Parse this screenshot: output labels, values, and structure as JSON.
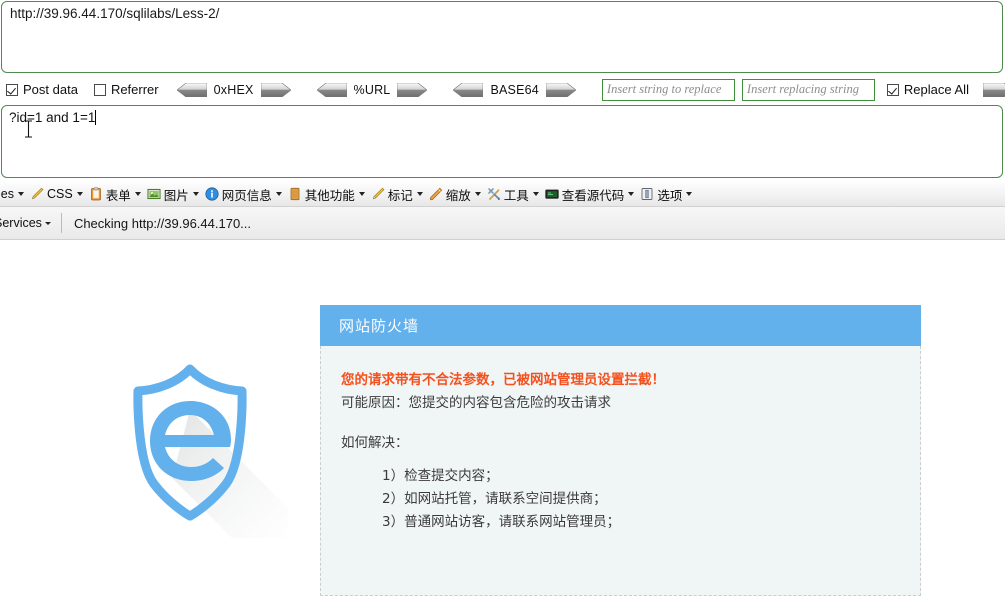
{
  "request_bar": {
    "url": "http://39.96.44.170/sqlilabs/Less-2/"
  },
  "options_toolbar": {
    "post_data": {
      "label": "Post data",
      "checked": true
    },
    "referrer": {
      "label": "Referrer",
      "checked": false
    },
    "encoders": [
      {
        "label": "0xHEX",
        "left_icon": "left-arrow-icon",
        "right_icon": "right-arrow-icon"
      },
      {
        "label": "%URL",
        "left_icon": "left-arrow-icon",
        "right_icon": "right-arrow-icon"
      },
      {
        "label": "BASE64",
        "left_icon": "left-arrow-icon",
        "right_icon": "right-arrow-icon"
      }
    ],
    "replace_search": {
      "value": "",
      "placeholder": "Insert string to replace"
    },
    "replace_with": {
      "value": "",
      "placeholder": "Insert replacing string"
    },
    "replace_all": {
      "label": "Replace All",
      "checked": true
    },
    "go_filled_icon": "right-arrow-filled-icon",
    "go_outline_icon": "right-arrow-outline-icon"
  },
  "payload_box": {
    "value": "?id=1 and 1=1",
    "cursor_icon": "text-ibeam-cursor"
  },
  "menu_bar": {
    "items": [
      {
        "label": "ies",
        "icon": "cookie-icon",
        "truncated": true
      },
      {
        "label": "CSS",
        "icon": "pencil-icon"
      },
      {
        "label": "表单",
        "icon": "clipboard-icon"
      },
      {
        "label": "图片",
        "icon": "picture-icon"
      },
      {
        "label": "网页信息",
        "icon": "info-circle-icon"
      },
      {
        "label": "其他功能",
        "icon": "book-icon"
      },
      {
        "label": "标记",
        "icon": "pencil-icon"
      },
      {
        "label": "缩放",
        "icon": "ruler-icon"
      },
      {
        "label": "工具",
        "icon": "tools-icon"
      },
      {
        "label": "查看源代码",
        "icon": "monitor-icon"
      },
      {
        "label": "选项",
        "icon": "options-icon"
      }
    ]
  },
  "status_bar": {
    "services_label": "Services",
    "status_text": "Checking http://39.96.44.170..."
  },
  "content": {
    "logo": {
      "icon": "shield-e-icon",
      "color": "#62b0ec"
    },
    "panel": {
      "title": "网站防火墙",
      "header_color": "#62b0ec",
      "body_color": "#f0f5f6",
      "warning": "您的请求带有不合法参数，已被网站管理员设置拦截！",
      "warning_color": "#f4511e",
      "reason": "可能原因：您提交的内容包含危险的攻击请求",
      "howto_label": "如何解决：",
      "steps": [
        "1）检查提交内容；",
        "2）如网站托管，请联系空间提供商；",
        "3）普通网站访客，请联系网站管理员；"
      ]
    }
  }
}
